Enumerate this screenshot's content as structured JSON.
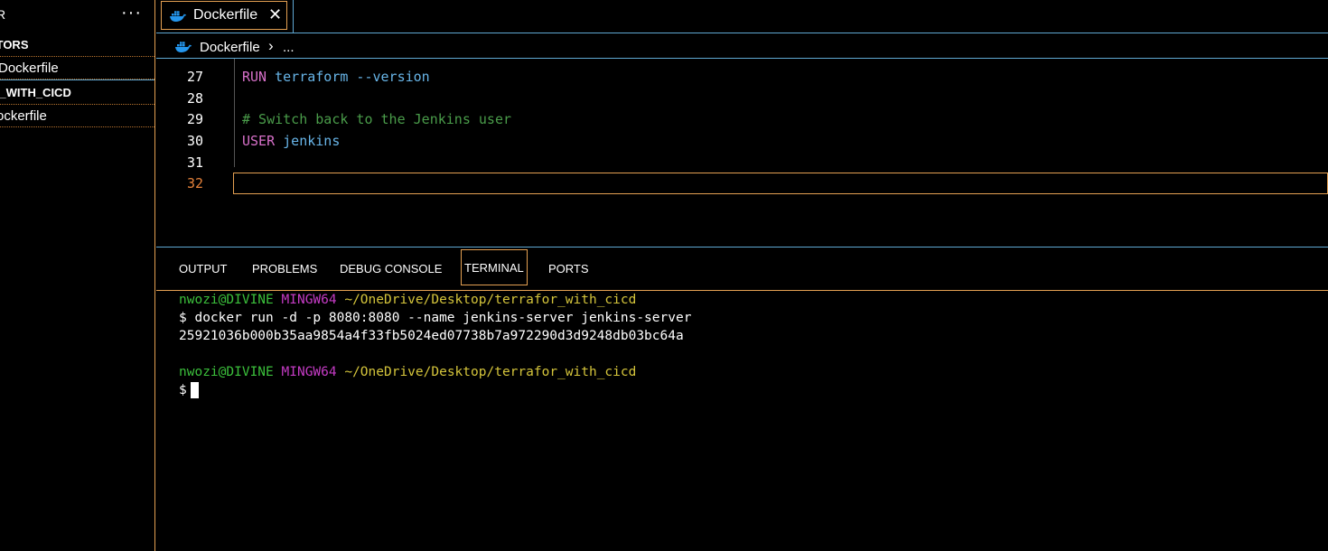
{
  "sidebar": {
    "title": "R",
    "more": "···",
    "section_open_editors": "ITORS",
    "open_editor_file": "Dockerfile",
    "section_project": "R_WITH_CICD",
    "project_file": "ockerfile"
  },
  "tabbar": {
    "tab_label": "Dockerfile",
    "close_glyph": "✕"
  },
  "breadcrumb": {
    "file": "Dockerfile",
    "chevron": "›",
    "more": "..."
  },
  "editor": {
    "lines": [
      {
        "num": "27",
        "keyword": "RUN",
        "rest": "terraform --version"
      },
      {
        "num": "28",
        "text": ""
      },
      {
        "num": "29",
        "comment": "# Switch back to the Jenkins user"
      },
      {
        "num": "30",
        "keyword": "USER",
        "rest": "jenkins"
      },
      {
        "num": "31",
        "text": ""
      },
      {
        "num": "32",
        "text": ""
      }
    ]
  },
  "panel": {
    "tabs": [
      "OUTPUT",
      "PROBLEMS",
      "DEBUG CONSOLE",
      "TERMINAL",
      "PORTS"
    ],
    "active": "TERMINAL"
  },
  "terminal": {
    "prompt_user": "nwozi@DIVINE",
    "prompt_sys": "MINGW64",
    "prompt_path": "~/OneDrive/Desktop/terrafor_with_cicd",
    "command": "$ docker run -d -p 8080:8080 --name jenkins-server jenkins-server",
    "output": "25921036b000b35aa9854a4f33fb5024ed07738b7a972290d3d9248db03bc64a",
    "prompt_symbol": "$"
  },
  "colors": {
    "accent_orange": "#e4a052",
    "border_blue": "#5fa8d3",
    "docker_blue": "#2496ed"
  }
}
